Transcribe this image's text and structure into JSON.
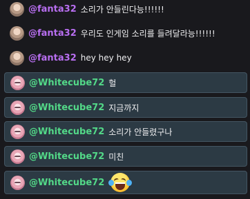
{
  "messages": [
    {
      "username": "@fanta32",
      "text": "소리가 안들린다능!!!!!!",
      "highlighted": false
    },
    {
      "username": "@fanta32",
      "text": "우리도 인게임 소리를 들려달라능!!!!!!",
      "highlighted": false
    },
    {
      "username": "@fanta32",
      "text": "hey hey hey",
      "highlighted": false
    },
    {
      "username": "@Whitecube72",
      "text": "헐",
      "highlighted": true
    },
    {
      "username": "@Whitecube72",
      "text": "지금까지",
      "highlighted": true
    },
    {
      "username": "@Whitecube72",
      "text": "소리가 안들렸구나",
      "highlighted": true
    },
    {
      "username": "@Whitecube72",
      "text": "미친",
      "highlighted": true
    },
    {
      "username": "@Whitecube72",
      "text": "",
      "emote": "face-with-tears-of-joy",
      "highlighted": true
    }
  ],
  "colors": {
    "background": "#19191d",
    "highlight_bg": "#2c3a44",
    "highlight_border": "#445663",
    "fanta32_name": "#b86ef0",
    "whitecube72_name": "#53d988",
    "message_text": "#efeff1"
  }
}
